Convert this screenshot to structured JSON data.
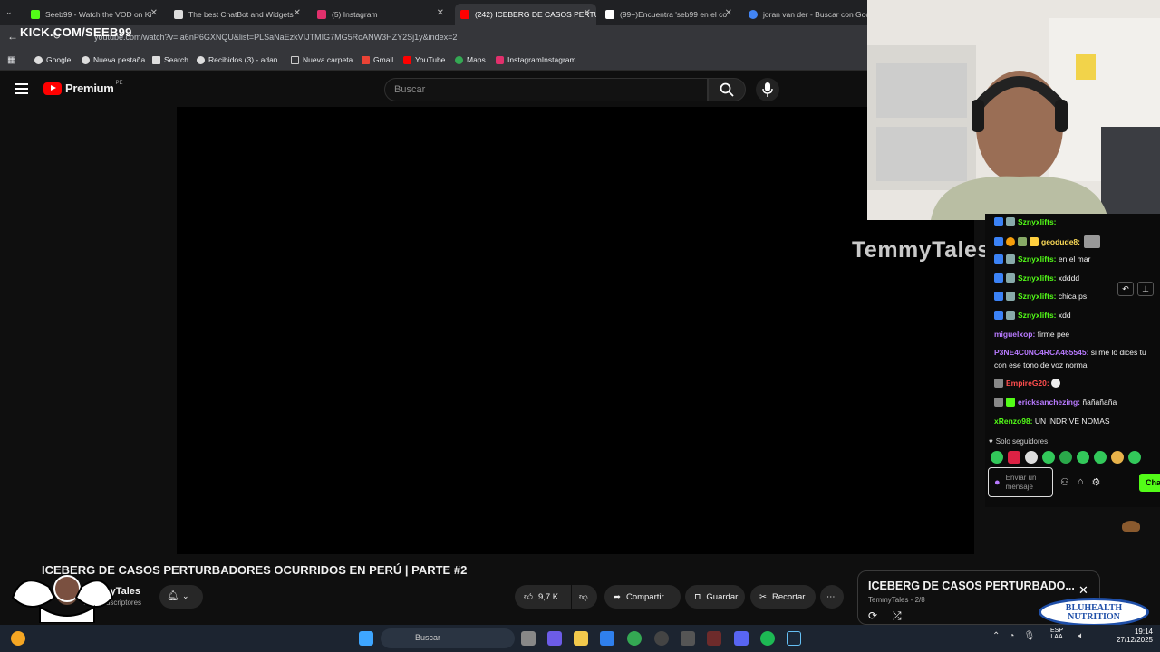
{
  "tabs": [
    {
      "label": "Seeb99 - Watch the VOD on Ki",
      "color": "#53fc18"
    },
    {
      "label": "The best ChatBot and Widgets",
      "color": "#ffffff"
    },
    {
      "label": "(5) Instagram",
      "color": "#e1306c"
    },
    {
      "label": "(242) ICEBERG DE CASOS PERTU",
      "color": "#ff0000"
    },
    {
      "label": "(99+)Encuentra 'seb99 en el co",
      "color": "#ffffff"
    },
    {
      "label": "joran van der - Buscar con Goo",
      "color": "#4285f4"
    }
  ],
  "address": {
    "url": "youtube.com/watch?v=Ia6nP6GXNQU&list=PLSaNaEzkVIJTMIG7MG5RoANW3HZY2Sj1y&index=2"
  },
  "overlay": {
    "kick": "KICK.COM/SEEB99"
  },
  "bookmarks": [
    "Google",
    "Nueva pestaña",
    "Search",
    "Recibidos (3) - adan...",
    "Nueva carpeta",
    "Gmail",
    "YouTube",
    "Maps",
    "InstagramInstagram..."
  ],
  "youtube": {
    "logo": "Premium",
    "region": "PE",
    "search_placeholder": "Buscar"
  },
  "video": {
    "watermark": "TemmyTales"
  },
  "chat": {
    "messages": [
      {
        "user": "Sznyxlifts:",
        "text": "",
        "color": "#53fc18"
      },
      {
        "user": "geodude8:",
        "text": "",
        "color": "#ffde59"
      },
      {
        "user": "Sznyxlifts:",
        "text": "en el mar",
        "color": "#53fc18"
      },
      {
        "user": "Sznyxlifts:",
        "text": "xdddd",
        "color": "#53fc18"
      },
      {
        "user": "Sznyxlifts:",
        "text": "chica ps",
        "color": "#53fc18"
      },
      {
        "user": "Sznyxlifts:",
        "text": "xdd",
        "color": "#53fc18"
      },
      {
        "user": "miguelxop:",
        "text": "firme pee",
        "color": "#b87aff"
      },
      {
        "user": "P3NE4C0NC4RCA465545:",
        "text": "si me lo dices tu",
        "text2": "con ese tono de voz normal",
        "color": "#b87aff"
      },
      {
        "user": "EmpireG20:",
        "text": "",
        "color": "#ff4d4d"
      },
      {
        "user": "ericksanchezing:",
        "text": "ñañañaña",
        "color": "#b87aff"
      },
      {
        "user": "xRenzo98:",
        "text": "UN INDRIVE NOMAS",
        "color": "#53fc18"
      }
    ],
    "followers_only": "Solo seguidores",
    "input_placeholder": "Enviar un mensaje",
    "send_label": "Cha"
  },
  "meta": {
    "title": "ICEBERG DE CASOS PERTURBADORES OCURRIDOS EN PERÚ | PARTE #2",
    "channel": "TemmyTales",
    "subscribers": "9,4 K suscriptores",
    "likes": "9,7 K",
    "share": "Compartir",
    "save": "Guardar",
    "clip": "Recortar"
  },
  "playlist": {
    "title": "ICEBERG DE CASOS PERTURBADO...",
    "subtitle": "TemmyTales - 2/8"
  },
  "brand": {
    "line1": "BLUHEALTH",
    "line2": "NUTRITION"
  },
  "taskbar": {
    "search": "Buscar",
    "lang1": "ESP",
    "lang2": "LAA",
    "time": "19:14",
    "date": "27/12/2025"
  },
  "colors": {
    "yt_red": "#ff0000",
    "kick_green": "#53fc18",
    "accent": "#3ea6ff"
  }
}
